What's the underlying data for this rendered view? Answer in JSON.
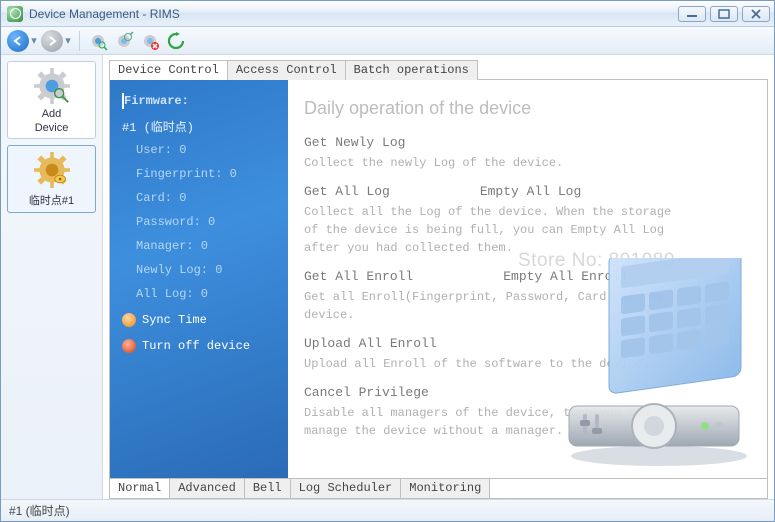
{
  "window": {
    "title": "Device Management - RIMS"
  },
  "left": {
    "add_label_line1": "Add",
    "add_label_line2": "Device",
    "device_label": "临时点#1"
  },
  "top_tabs": [
    "Device Control",
    "Access Control",
    "Batch operations"
  ],
  "bluepane": {
    "header": "Firmware:",
    "device": "#1 (临时点)",
    "stats": [
      {
        "label": "User",
        "value": 0
      },
      {
        "label": "Fingerprint",
        "value": 0
      },
      {
        "label": "Card",
        "value": 0
      },
      {
        "label": "Password",
        "value": 0
      },
      {
        "label": "Manager",
        "value": 0
      },
      {
        "label": "Newly Log",
        "value": 0
      },
      {
        "label": "All Log",
        "value": 0
      }
    ],
    "sync_time": "Sync Time",
    "turn_off": "Turn off device"
  },
  "main": {
    "heading": "Daily operation of the device",
    "ops": [
      {
        "title": "Get Newly Log",
        "desc": "Collect the newly Log of the device."
      },
      {
        "title": "Get All Log",
        "title2": "Empty All Log",
        "desc": "Collect all the Log of the device.\nWhen the storage of the device is being full, you can Empty All Log after you had collected them."
      },
      {
        "title": "Get All Enroll",
        "title2": "Empty All Enroll",
        "desc": "Get all Enroll(Fingerprint, Password, Card) of the device."
      },
      {
        "title": "Upload All Enroll",
        "desc": "Upload all Enroll of the software to the device."
      },
      {
        "title": "Cancel Privilege",
        "desc": "Disable all managers of the device, then you can manage the device without a manager."
      }
    ]
  },
  "bottom_tabs": [
    "Normal",
    "Advanced",
    "Bell",
    "Log Scheduler",
    "Monitoring"
  ],
  "statusbar": "#1 (临时点)",
  "watermark": "Store No:  801980"
}
